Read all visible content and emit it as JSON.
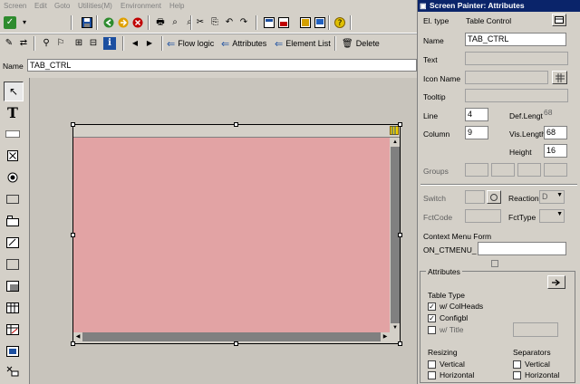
{
  "menu": [
    "Screen",
    "Edit",
    "Goto",
    "Utilities(M)",
    "Environment",
    "Help"
  ],
  "toolbar": {
    "flow_logic": "Flow logic",
    "attributes": "Attributes",
    "element_list": "Element List",
    "delete": "Delete"
  },
  "namebar": {
    "label": "Name",
    "value": "TAB_CTRL"
  },
  "panel": {
    "title": "Screen Painter: Attributes",
    "el_type_label": "El. type",
    "el_type_value": "Table Control",
    "name_label": "Name",
    "name_value": "TAB_CTRL",
    "text_label": "Text",
    "icon_name_label": "Icon Name",
    "tooltip_label": "Tooltip",
    "line_label": "Line",
    "line_value": "4",
    "def_length_label": "Def.Lengt",
    "def_length_value": "68",
    "column_label": "Column",
    "column_value": "9",
    "vis_length_label": "Vis.Length",
    "vis_length_value": "68",
    "height_label": "Height",
    "height_value": "16",
    "groups_label": "Groups",
    "switch_label": "Switch",
    "reaction_label": "Reaction",
    "reaction_value": "D",
    "fctcode_label": "FctCode",
    "fcttype_label": "FctType",
    "context_menu_label": "Context Menu Form",
    "on_ctmenu_label": "ON_CTMENU_",
    "attributes_group": "Attributes",
    "table_type_label": "Table Type",
    "w_colheads": "w/ ColHeads",
    "configbl": "Configbl",
    "w_title": "w/ Title",
    "resizing_label": "Resizing",
    "resizing_vertical": "Vertical",
    "resizing_horizontal": "Horizontal",
    "separators_label": "Separators",
    "separators_vertical": "Vertical",
    "separators_horizontal": "Horizontal"
  },
  "colors": {
    "table_body": "#e2a3a4",
    "title_bar": "#0a246a"
  }
}
